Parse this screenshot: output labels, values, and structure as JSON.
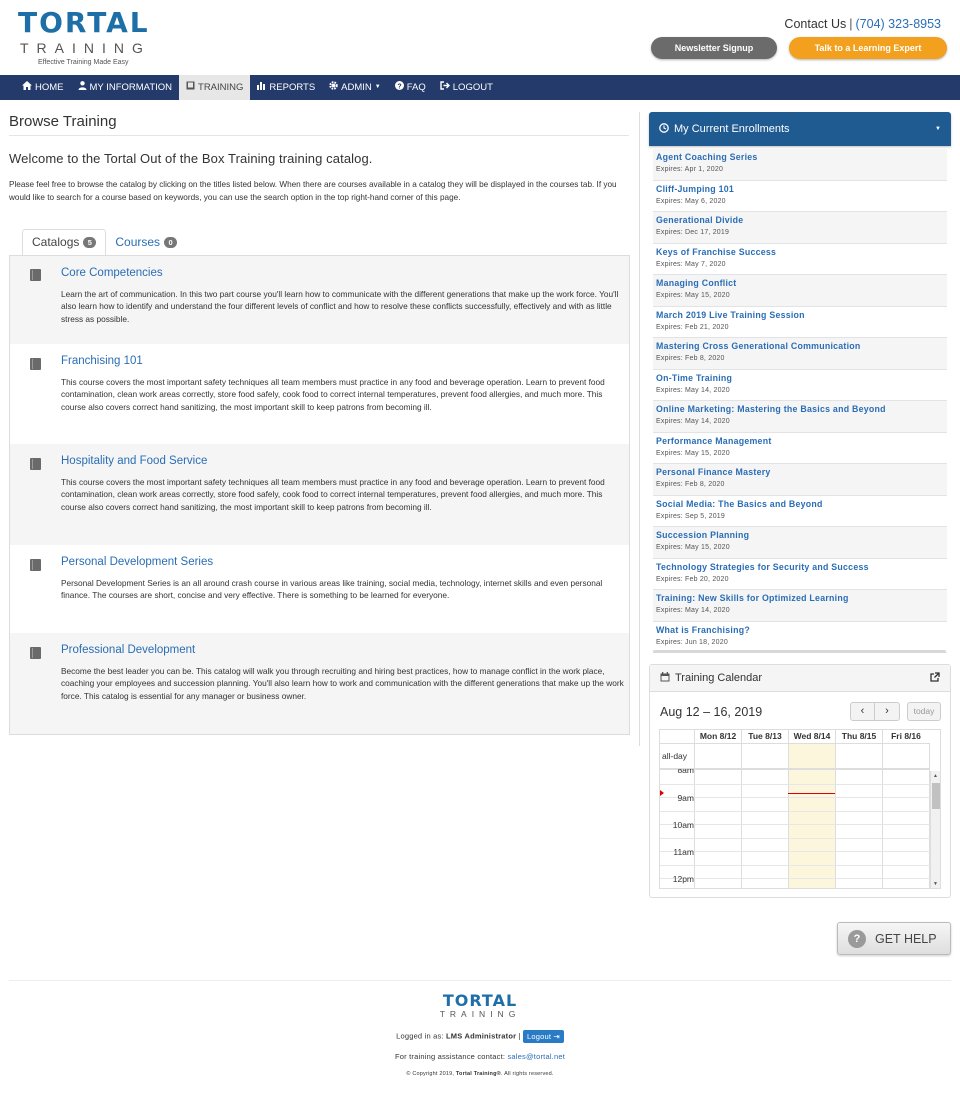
{
  "brand": {
    "logo_word": "TORTAL",
    "logo_sub": "TRAINING",
    "tagline": "Effective Training Made Easy"
  },
  "header": {
    "contact_label": "Contact Us",
    "separator": "|",
    "phone": "(704) 323-8953",
    "newsletter_label": "Newsletter Signup",
    "expert_label": "Talk to a Learning Expert"
  },
  "colors": {
    "nav_bg": "#243a6b",
    "accent_blue": "#2a6db5",
    "orange": "#f2a01e",
    "enroll_header": "#1f5a91"
  },
  "nav": {
    "items": [
      {
        "label": "HOME",
        "icon": "home-icon"
      },
      {
        "label": "MY INFORMATION",
        "icon": "user-icon"
      },
      {
        "label": "TRAINING",
        "icon": "book-icon"
      },
      {
        "label": "REPORTS",
        "icon": "bar-chart-icon"
      },
      {
        "label": "ADMIN",
        "icon": "gear-icon"
      },
      {
        "label": "FAQ",
        "icon": "question-icon"
      },
      {
        "label": "LOGOUT",
        "icon": "sign-out-icon"
      }
    ],
    "active": "TRAINING"
  },
  "main": {
    "title": "Browse Training",
    "welcome": "Welcome to the Tortal Out of the Box Training training catalog.",
    "intro": "Please feel free to browse the catalog by clicking on the titles listed below. When there are courses available in a catalog they will be displayed in the courses tab. If you would like to search for a course based on keywords, you can use the search option in the top right-hand corner of this page.",
    "tabs": [
      {
        "label": "Catalogs",
        "count": "5"
      },
      {
        "label": "Courses",
        "count": "0"
      }
    ],
    "catalogs": [
      {
        "title": "Core Competencies",
        "description": "Learn the art of communication. In this two part course you'll learn how to communicate with the different generations that make up the work force. You'll also learn how to identify and understand the four different levels of conflict and how to resolve these conflicts successfully, effectively and with as little stress as possible."
      },
      {
        "title": "Franchising 101",
        "description": "This course covers the most important safety techniques all team members must practice in any food and beverage operation. Learn to prevent food contamination, clean work areas correctly, store food safely, cook food to correct internal temperatures, prevent food allergies, and much more. This course also covers correct hand sanitizing, the most important skill to keep patrons from becoming ill."
      },
      {
        "title": "Hospitality and Food Service",
        "description": "This course covers the most important safety techniques all team members must practice in any food and beverage operation. Learn to prevent food contamination, clean work areas correctly, store food safely, cook food to correct internal temperatures, prevent food allergies, and much more. This course also covers correct hand sanitizing, the most important skill to keep patrons from becoming ill."
      },
      {
        "title": "Personal Development Series",
        "description": "Personal Development Series is an all around crash course in various areas like training, social media, technology, internet skills and even personal finance. The courses are short, concise and very effective. There is something to be learned for everyone."
      },
      {
        "title": "Professional Development",
        "description": "Become the best leader you can be. This catalog will walk you through recruiting and hiring best practices, how to manage conflict in the work place, coaching your employees and succession planning. You'll also learn how to work and communication with the different generations that make up the work force. This catalog is essential for any manager or business owner."
      }
    ]
  },
  "enrollments": {
    "title": "My Current Enrollments",
    "items": [
      {
        "title": "Agent Coaching Series",
        "expires": "Expires: Apr 1, 2020"
      },
      {
        "title": "Cliff-Jumping 101",
        "expires": "Expires: May 6, 2020"
      },
      {
        "title": "Generational Divide",
        "expires": "Expires: Dec 17, 2019"
      },
      {
        "title": "Keys of Franchise Success",
        "expires": "Expires: May 7, 2020"
      },
      {
        "title": "Managing Conflict",
        "expires": "Expires: May 15, 2020"
      },
      {
        "title": "March 2019 Live Training Session",
        "expires": "Expires: Feb 21, 2020"
      },
      {
        "title": "Mastering Cross Generational Communication",
        "expires": "Expires: Feb 8, 2020"
      },
      {
        "title": "On-Time Training",
        "expires": "Expires: May 14, 2020"
      },
      {
        "title": "Online Marketing: Mastering the Basics and Beyond",
        "expires": "Expires: May 14, 2020"
      },
      {
        "title": "Performance Management",
        "expires": "Expires: May 15, 2020"
      },
      {
        "title": "Personal Finance Mastery",
        "expires": "Expires: Feb 8, 2020"
      },
      {
        "title": "Social Media: The Basics and Beyond",
        "expires": "Expires: Sep 5, 2019"
      },
      {
        "title": "Succession Planning",
        "expires": "Expires: May 15, 2020"
      },
      {
        "title": "Technology Strategies for Security and Success",
        "expires": "Expires: Feb 20, 2020"
      },
      {
        "title": "Training: New Skills for Optimized Learning",
        "expires": "Expires: May 14, 2020"
      },
      {
        "title": "What is Franchising?",
        "expires": "Expires: Jun 18, 2020"
      }
    ]
  },
  "calendar": {
    "title": "Training Calendar",
    "range": "Aug 12 – 16, 2019",
    "prev": "‹",
    "next": "›",
    "today_label": "today",
    "days": [
      "Mon 8/12",
      "Tue 8/13",
      "Wed 8/14",
      "Thu 8/15",
      "Fri 8/16"
    ],
    "allday_label": "all-day",
    "times": [
      "8am",
      "9am",
      "10am",
      "11am",
      "12pm"
    ]
  },
  "help": {
    "label": "GET HELP",
    "icon_glyph": "?"
  },
  "footer": {
    "logged_in_prefix": "Logged in as:",
    "user": "LMS Administrator",
    "separator": "|",
    "logout_label": "Logout",
    "assist_text": "For training assistance contact:",
    "assist_email": "sales@tortal.net",
    "copyright_prefix": "© Copyright 2019,",
    "copyright_brand": "Tortal Training®",
    "copyright_suffix": ". All rights reserved."
  }
}
